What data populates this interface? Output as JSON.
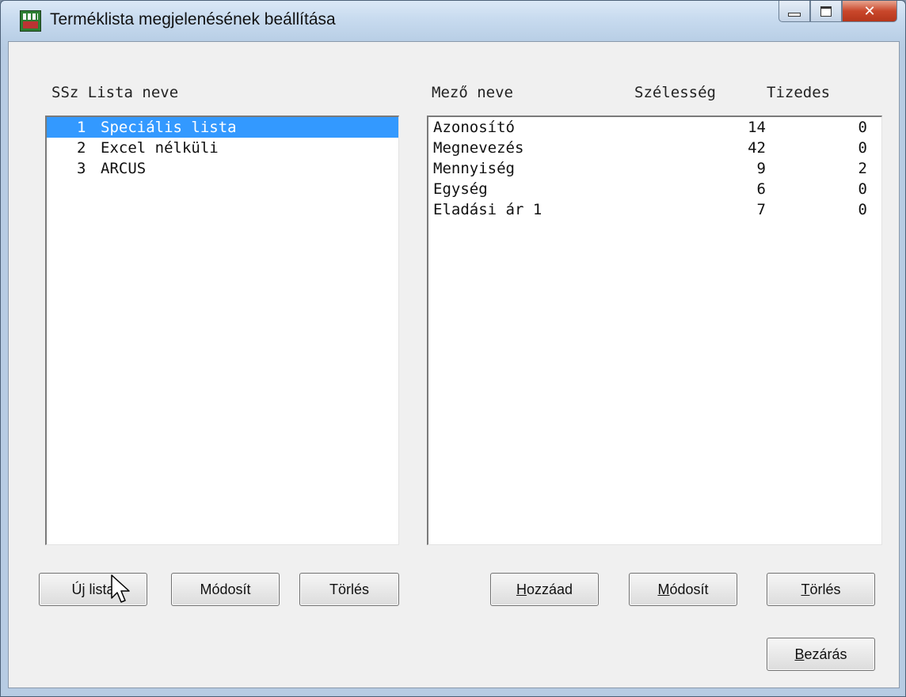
{
  "window": {
    "title": "Terméklista megjelenésének beállítása",
    "caption_buttons": {
      "minimize": "minimize-icon",
      "maximize": "maximize-icon",
      "close": "✕"
    }
  },
  "lists_panel": {
    "header": "SSz Lista neve",
    "items": [
      {
        "num": "1",
        "name": "Speciális lista",
        "selected": true
      },
      {
        "num": "2",
        "name": "Excel nélküli",
        "selected": false
      },
      {
        "num": "3",
        "name": "ARCUS",
        "selected": false
      }
    ],
    "buttons": {
      "new": "Új lista",
      "modify": "Módosít",
      "delete": "Törlés"
    }
  },
  "fields_panel": {
    "header_name": "Mező neve",
    "header_width": "Szélesség",
    "header_decimals": "Tizedes",
    "rows": [
      {
        "name": "Azonosító",
        "width": "14",
        "decimals": "0"
      },
      {
        "name": "Megnevezés",
        "width": "42",
        "decimals": "0"
      },
      {
        "name": "Mennyiség",
        "width": "9",
        "decimals": "2"
      },
      {
        "name": "Egység",
        "width": "6",
        "decimals": "0"
      },
      {
        "name": "Eladási ár 1",
        "width": "7",
        "decimals": "0"
      }
    ],
    "buttons": {
      "add_mnemonic": "H",
      "add_rest": "ozzáad",
      "modify_mnemonic": "M",
      "modify_rest": "ódosít",
      "delete_mnemonic": "T",
      "delete_rest": "örlés"
    }
  },
  "close_button": {
    "mnemonic": "B",
    "rest": "ezárás"
  },
  "colors": {
    "selection": "#3399ff",
    "window_bg": "#f0f0f0"
  }
}
